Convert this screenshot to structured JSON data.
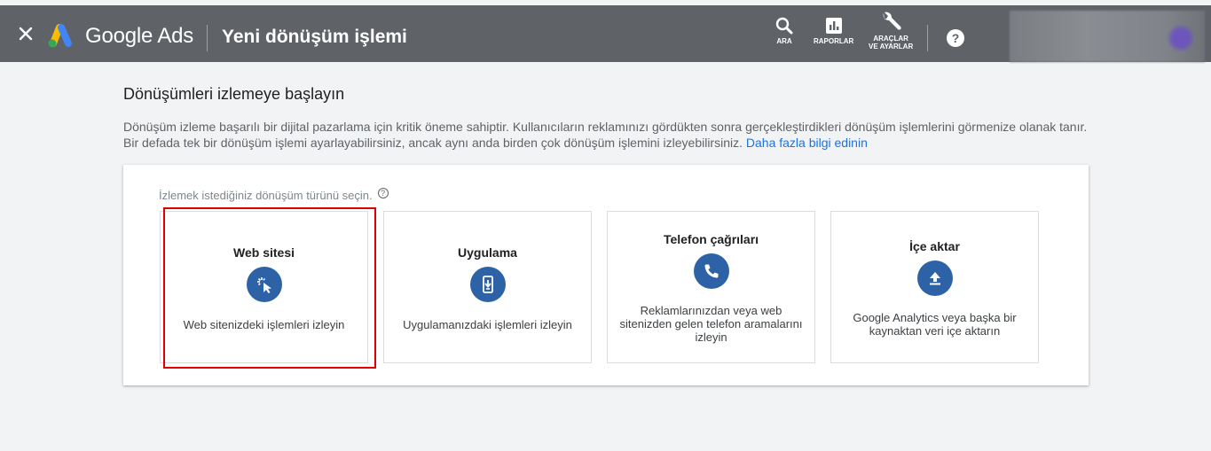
{
  "header": {
    "brand": "Google Ads",
    "title": "Yeni dönüşüm işlemi",
    "tools": {
      "search": "ARA",
      "reports": "RAPORLAR",
      "tools_settings": "ARAÇLAR\nVE AYARLAR"
    },
    "help": "?",
    "colors": {
      "bar": "#5f6368",
      "logo_blue": "#4285f4",
      "logo_yellow": "#fbbc04",
      "logo_green": "#34a853"
    }
  },
  "main": {
    "heading": "Dönüşümleri izlemeye başlayın",
    "description": "Dönüşüm izleme başarılı bir dijital pazarlama için kritik öneme sahiptir. Kullanıcıların reklamınızı gördükten sonra gerçekleştirdikleri dönüşüm işlemlerini görmenize olanak tanır. Bir defada tek bir dönüşüm işlemi ayarlayabilirsiniz, ancak aynı anda birden çok dönüşüm işlemini izleyebilirsiniz.",
    "learn_more": "Daha fazla bilgi edinin",
    "prompt": "İzlemek istediğiniz dönüşüm türünü seçin.",
    "cards": [
      {
        "title": "Web sitesi",
        "icon": "cursor-click-icon",
        "description": "Web sitenizdeki işlemleri izleyin"
      },
      {
        "title": "Uygulama",
        "icon": "phone-download-icon",
        "description": "Uygulamanızdaki işlemleri izleyin"
      },
      {
        "title": "Telefon çağrıları",
        "icon": "phone-call-icon",
        "description": "Reklamlarınızdan veya web sitenizden gelen telefon aramalarını izleyin"
      },
      {
        "title": "İçe aktar",
        "icon": "upload-icon",
        "description": "Google Analytics veya başka bir kaynaktan veri içe aktarın"
      }
    ],
    "selected_card": "Web sitesi",
    "colors": {
      "icon_circle": "#2d63a6",
      "link": "#1a73e8",
      "highlight": "#e00000"
    }
  }
}
